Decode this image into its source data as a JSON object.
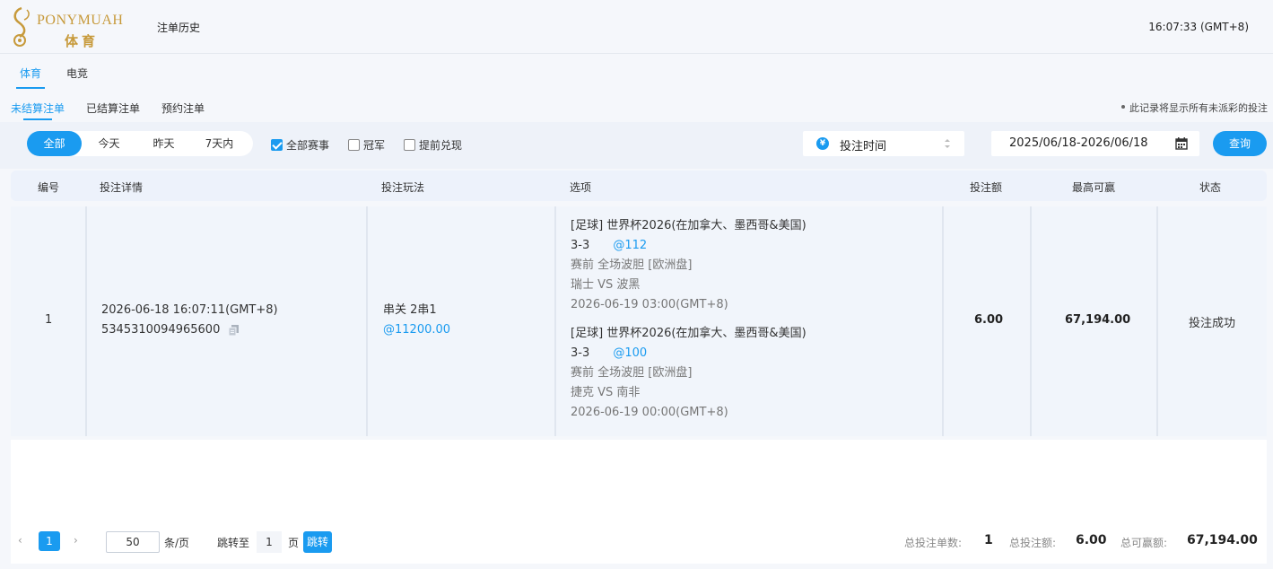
{
  "header": {
    "logo_text": "PONYMUAH",
    "logo_sub": "体育",
    "title": "注单历史",
    "time": "16:07:33 (GMT+8)"
  },
  "main_tabs": [
    {
      "label": "体育",
      "active": true
    },
    {
      "label": "电竞",
      "active": false
    }
  ],
  "sub_tabs": [
    {
      "label": "未结算注单",
      "active": true
    },
    {
      "label": "已结算注单",
      "active": false
    },
    {
      "label": "预约注单",
      "active": false
    }
  ],
  "notice": "此记录将显示所有未派彩的投注",
  "filters": {
    "ranges": [
      {
        "label": "全部",
        "active": true
      },
      {
        "label": "今天",
        "active": false
      },
      {
        "label": "昨天",
        "active": false
      },
      {
        "label": "7天内",
        "active": false
      }
    ],
    "checkboxes": [
      {
        "label": "全部赛事",
        "checked": true
      },
      {
        "label": "冠军",
        "checked": false
      },
      {
        "label": "提前兑现",
        "checked": false
      }
    ],
    "sort_icon": "¥",
    "sort_label": "投注时间",
    "date_range": "2025/06/18-2026/06/18",
    "query_label": "查询"
  },
  "table": {
    "headers": [
      "编号",
      "投注详情",
      "投注玩法",
      "选项",
      "投注额",
      "最高可赢",
      "状态"
    ],
    "rows": [
      {
        "index": "1",
        "bet_time": "2026-06-18 16:07:11(GMT+8)",
        "bet_id": "5345310094965600",
        "play_type": "串关 2串1",
        "play_odds": "@11200.00",
        "selections": [
          {
            "event": "[足球] 世界杯2026(在加拿大、墨西哥&美国)",
            "pick": "3-3",
            "odds": "@112",
            "market": "赛前 全场波胆 [欧洲盘]",
            "match": "瑞士 VS 波黑",
            "kickoff": "2026-06-19 03:00(GMT+8)"
          },
          {
            "event": "[足球] 世界杯2026(在加拿大、墨西哥&美国)",
            "pick": "3-3",
            "odds": "@100",
            "market": "赛前 全场波胆 [欧洲盘]",
            "match": "捷克 VS 南非",
            "kickoff": "2026-06-19 00:00(GMT+8)"
          }
        ],
        "stake": "6.00",
        "max_win": "67,194.00",
        "status": "投注成功"
      }
    ]
  },
  "pagination": {
    "current_page": "1",
    "page_size": "50",
    "page_size_unit": "条/页",
    "jump_label": "跳转至",
    "jump_value": "1",
    "page_unit": "页",
    "jump_button": "跳转"
  },
  "summary": {
    "count_label": "总投注单数:",
    "count_value": "1",
    "stake_label": "总投注额:",
    "stake_value": "6.00",
    "win_label": "总可赢额:",
    "win_value": "67,194.00"
  },
  "colors": {
    "accent": "#1a9bf0",
    "logo_gold": "#c79a3b"
  }
}
